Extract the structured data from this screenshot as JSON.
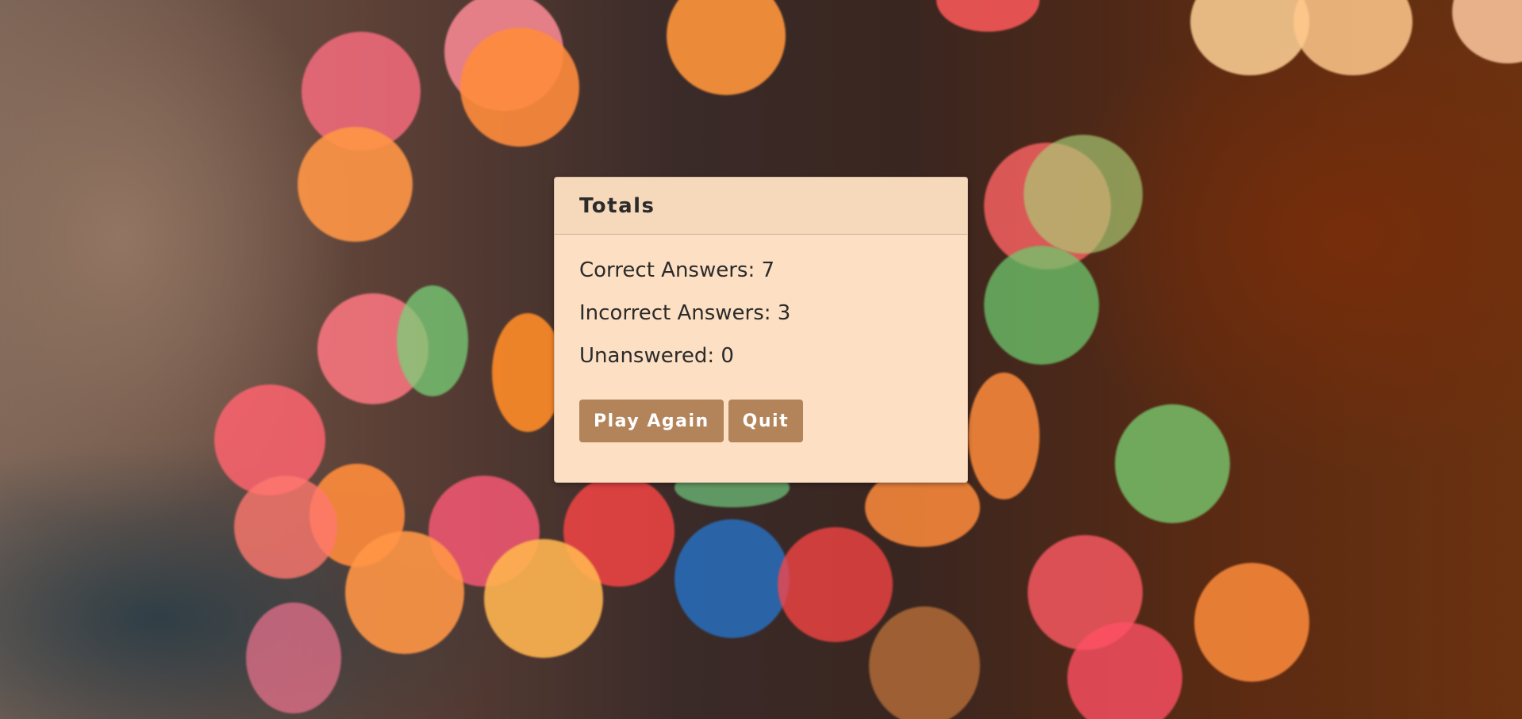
{
  "results": {
    "title": "Totals",
    "correct": "Correct Answers: 7",
    "incorrect": "Incorrect Answers: 3",
    "unanswered": "Unanswered: 0"
  },
  "actions": {
    "play_again_label": "Play Again",
    "quit_label": "Quit"
  },
  "colors": {
    "card_bg": "#fde0c3",
    "card_header_bg": "#f6d9bb",
    "button_bg": "#b3845a",
    "button_text": "#ffffff",
    "text": "#2b2b2b"
  }
}
